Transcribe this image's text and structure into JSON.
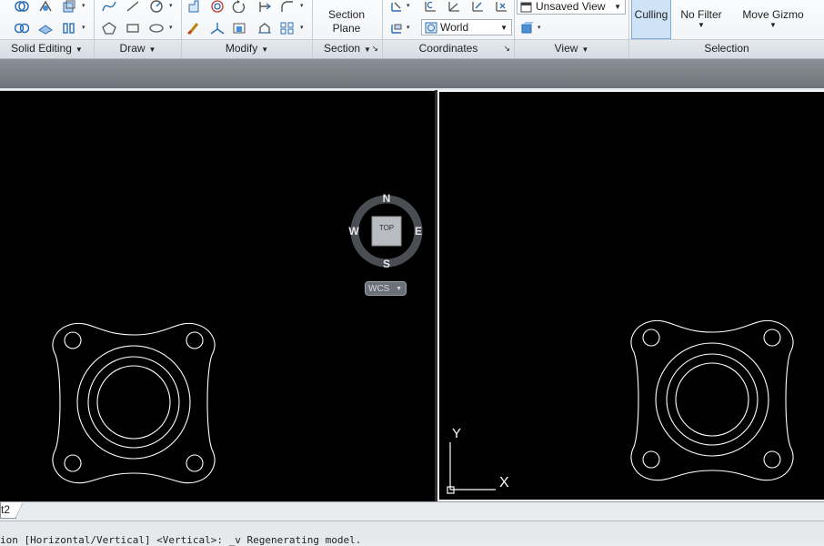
{
  "ribbon": {
    "panels": {
      "solid_editing": "Solid Editing",
      "draw": "Draw",
      "modify": "Modify",
      "section": "Section",
      "coordinates": "Coordinates",
      "view": "View",
      "selection": "Selection"
    },
    "section_plane": {
      "line1": "Section",
      "line2": "Plane"
    },
    "view_combo": "Unsaved View",
    "ucs_combo": "World",
    "culling": "Culling",
    "no_filter": "No Filter",
    "move_gizmo": "Move Gizmo"
  },
  "viewcube": {
    "north": "N",
    "south": "S",
    "east": "E",
    "west": "W",
    "face": "TOP",
    "wcs": "WCS"
  },
  "ucs_icon": {
    "x": "X",
    "y": "Y"
  },
  "layout_tab": "t2",
  "command_line": "ion [Horizontal/Vertical] <Vertical>: _v Regenerating model.",
  "colors": {
    "viewport_bg": "#000000",
    "drawing_lines": "#ffffff",
    "active_border": "#f2f2f2",
    "ribbon_accent": "#cfe3f7"
  }
}
